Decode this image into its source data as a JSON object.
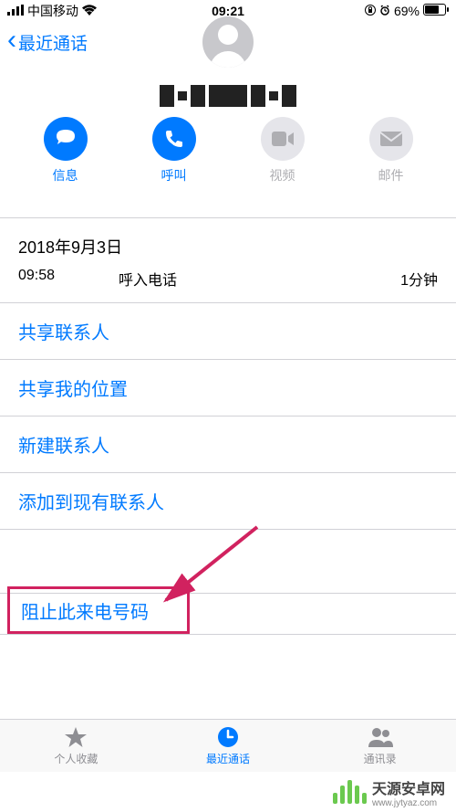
{
  "status": {
    "carrier": "中国移动",
    "time": "09:21",
    "battery": "69%"
  },
  "nav": {
    "back": "最近通话"
  },
  "actions": {
    "message": "信息",
    "call": "呼叫",
    "video": "视频",
    "mail": "邮件"
  },
  "history": {
    "date": "2018年9月3日",
    "time": "09:58",
    "type": "呼入电话",
    "duration": "1分钟"
  },
  "menu": {
    "share_contact": "共享联系人",
    "share_location": "共享我的位置",
    "new_contact": "新建联系人",
    "add_existing": "添加到现有联系人",
    "block": "阻止此来电号码"
  },
  "tabs": {
    "favorites": "个人收藏",
    "recents": "最近通话",
    "contacts": "通讯录"
  },
  "watermark": {
    "main": "天源安卓网",
    "sub": "www.jytyaz.com"
  }
}
